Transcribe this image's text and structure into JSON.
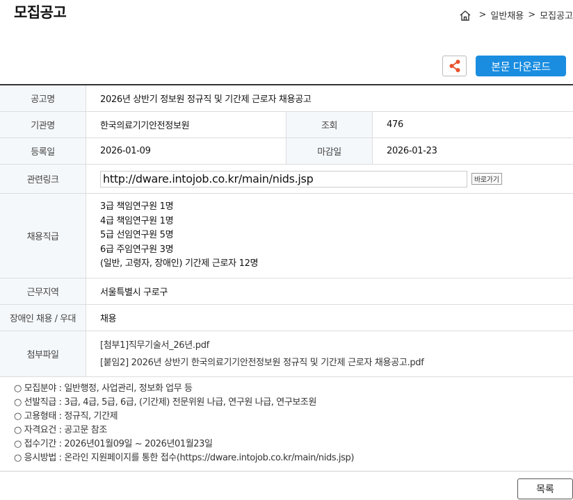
{
  "page_title": "모집공고",
  "breadcrumb": {
    "items": [
      "일반채용",
      "모집공고"
    ],
    "separator": ">"
  },
  "actions": {
    "download_label": "본문 다운로드",
    "share_icon": "share-icon",
    "list_label": "목록"
  },
  "table": {
    "title_label": "공고명",
    "title_value": "2026년 상반기 정보원 정규직 및 기간제 근로자 채용공고",
    "org_label": "기관명",
    "org_value": "한국의료기기안전정보원",
    "views_label": "조회",
    "views_value": "476",
    "reg_label": "등록일",
    "reg_value": "2026-01-09",
    "deadline_label": "마감일",
    "deadline_value": "2026-01-23",
    "link_label": "관련링크",
    "link_value": "http://dware.intojob.co.kr/main/nids.jsp",
    "link_go": "바로가기",
    "grade_label": "채용직급",
    "grades": [
      "3급 책임연구원 1명",
      "4급 책임연구원 1명",
      "5급 선임연구원 5명",
      "6급 주임연구원 3명",
      "(일반, 고령자, 장애인) 기간제 근로자 12명"
    ],
    "region_label": "근무지역",
    "region_value": "서울특별시 구로구",
    "disabled_label": "장애인 채용 / 우대",
    "disabled_value": "채용",
    "attach_label": "첨부파일",
    "attachments": [
      "[첨부1]직무기술서_26년.pdf",
      "[붙임2] 2026년 상반기 한국의료기기안전정보원 정규직 및 기간제 근로자 채용공고.pdf"
    ]
  },
  "notes": [
    "○ 모집분야 : 일반행정, 사업관리, 정보화 업무 등",
    "○ 선발직급 : 3급, 4급, 5급, 6급, (기간제) 전문위원 나급, 연구원 나급, 연구보조원",
    "○ 고용형태 : 정규직, 기간제",
    "○ 자격요건 : 공고문 참조",
    "○ 접수기간 : 2026년01월09일 ~ 2026년01월23일",
    "○ 응시방법 : 온라인 지원페이지를 통한 접수(https://dware.intojob.co.kr/main/nids.jsp)"
  ]
}
